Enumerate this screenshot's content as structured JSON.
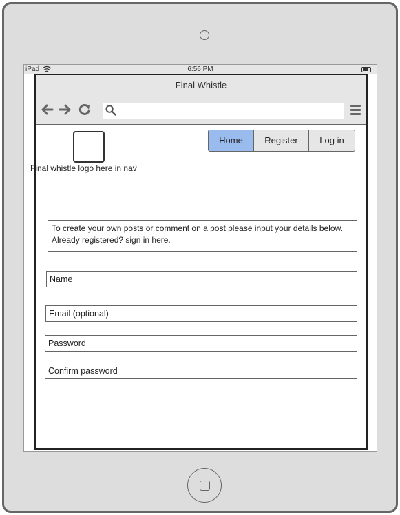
{
  "status_bar": {
    "carrier": "iPad",
    "time": "6:56 PM"
  },
  "browser": {
    "title": "Final Whistle",
    "url": ""
  },
  "header": {
    "logo_caption": "Final whistle logo here in nav",
    "nav": {
      "home": "Home",
      "register": "Register",
      "login": "Log in",
      "active": "Home"
    }
  },
  "main": {
    "info_text": "To create your own posts or comment on a post please input your details below. Already registered? sign in here.",
    "fields": {
      "name": "Name",
      "email": "Email (optional)",
      "password": "Password",
      "confirm_password": "Confirm password"
    }
  },
  "colors": {
    "active_nav": "#99bbee",
    "device_frame": "#dddddd",
    "chrome_bar": "#e6e6e6"
  }
}
